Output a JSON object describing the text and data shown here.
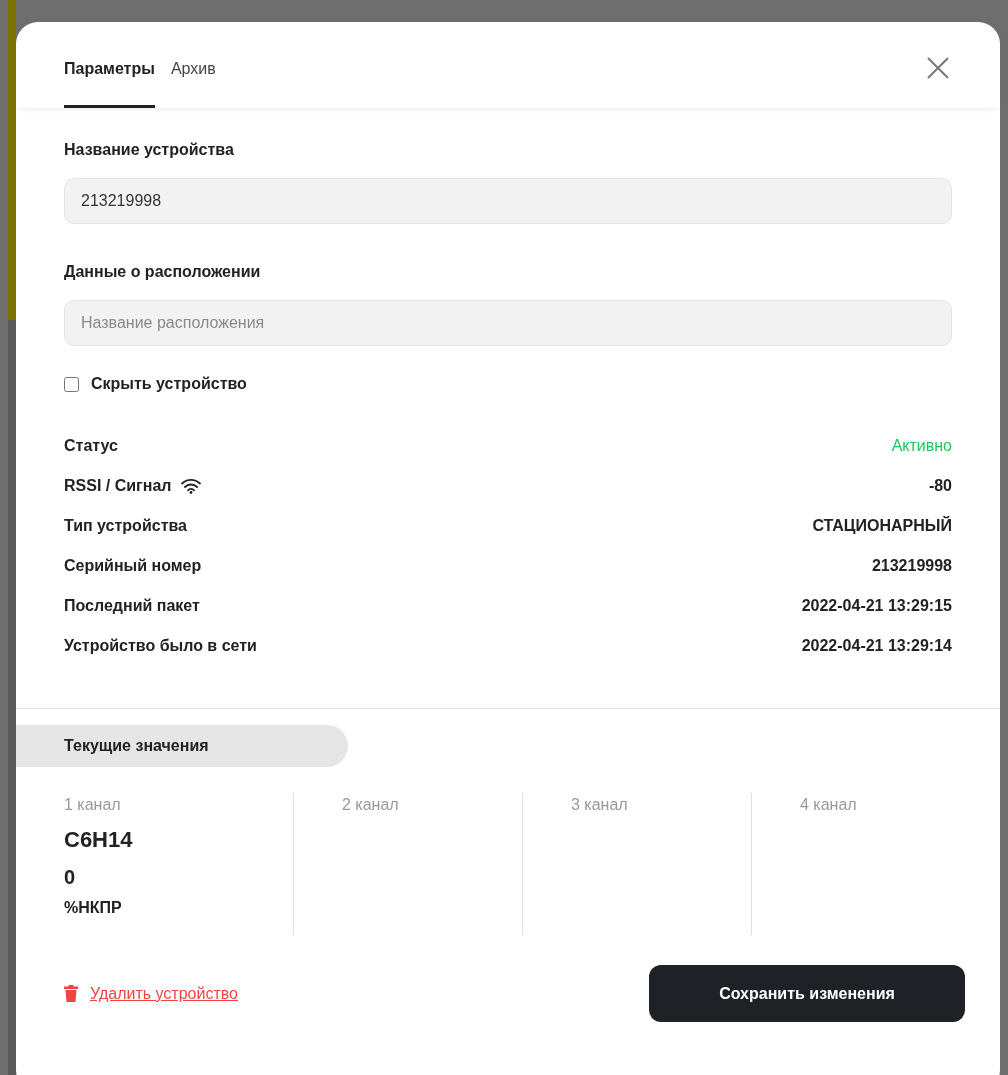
{
  "tabs": [
    {
      "label": "Параметры",
      "selected": true
    },
    {
      "label": "Архив",
      "selected": false
    }
  ],
  "fields": [
    {
      "label": "Название устройства",
      "value": "213219998"
    },
    {
      "label": "Данные о расположении",
      "placeholder": "Название расположения"
    }
  ],
  "hide_device": {
    "label": "Скрыть устройство",
    "checked": false
  },
  "info": [
    {
      "label": "Статус",
      "value": "Активно",
      "kind": "status",
      "color": "#22c55e"
    },
    {
      "label": "RSSI / Сигнал",
      "value": "-80",
      "kind": "signal"
    },
    {
      "label": "Тип устройства",
      "value": "СТАЦИОНАРНЫЙ",
      "kind": "plain"
    },
    {
      "label": "Серийный номер",
      "value": "213219998",
      "kind": "plain"
    },
    {
      "label": "Последний пакет",
      "value": "2022-04-21 13:29:15",
      "kind": "plain"
    },
    {
      "label": "Устройство было в сети",
      "value": "2022-04-21 13:29:14",
      "kind": "plain"
    }
  ],
  "current_values": {
    "title": "Текущие значения",
    "channels": [
      {
        "label": "1 канал",
        "gas": "C6H14",
        "value": "0",
        "unit": "%НКПР"
      },
      {
        "label": "2 канал"
      },
      {
        "label": "3 канал"
      },
      {
        "label": "4 канал"
      }
    ]
  },
  "delete_link": "Удалить устройство",
  "save_button": "Сохранить изменения"
}
